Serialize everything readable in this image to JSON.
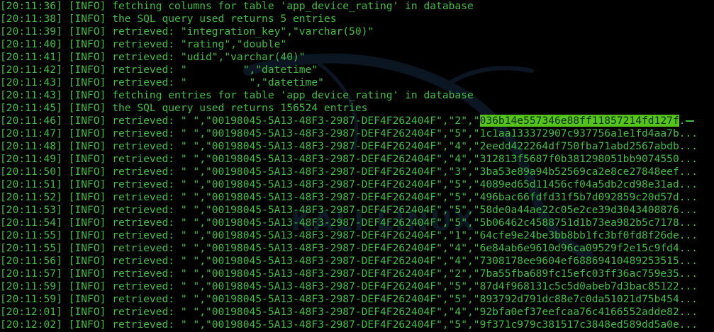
{
  "watermark": {
    "text": "KALI LINUX"
  },
  "lines": [
    {
      "time": "[20:11:36]",
      "level": "[INFO]",
      "msg": "fetching columns for table 'app_device_rating' in database"
    },
    {
      "time": "[20:11:38]",
      "level": "[INFO]",
      "msg": "the SQL query used returns 5 entries"
    },
    {
      "time": "[20:11:39]",
      "level": "[INFO]",
      "msg": "retrieved: \"integration_key\",\"varchar(50)\""
    },
    {
      "time": "[20:11:40]",
      "level": "[INFO]",
      "msg": "retrieved: \"rating\",\"double\""
    },
    {
      "time": "[20:11:41]",
      "level": "[INFO]",
      "msg": "retrieved: \"udid\",\"varchar(40)\""
    },
    {
      "time": "[20:11:42]",
      "level": "[INFO]",
      "msg": "retrieved: \"         \",\"datetime\""
    },
    {
      "time": "[20:11:43]",
      "level": "[INFO]",
      "msg": "retrieved: \"          \",\"datetime\""
    },
    {
      "time": "[20:11:43]",
      "level": "[INFO]",
      "msg": "fetching entries for table 'app_device_rating' in database"
    },
    {
      "time": "[20:11:45]",
      "level": "[INFO]",
      "msg": "the SQL query used returns 156524 entries"
    },
    {
      "time": "[20:11:46]",
      "level": "[INFO]",
      "msg": "retrieved: \" \",\"00198045-5A13-48F3-2987-DEF4F262404F\",\"2\",\"",
      "highlight": "036b14e557346e88ff11857214fd127f",
      "tail": ".",
      "cursor": true
    },
    {
      "time": "[20:11:47]",
      "level": "[INFO]",
      "msg": "retrieved: \" \",\"00198045-5A13-48F3-2987-DEF4F262404F\",\"5\",\"1c1aa133372907c937756a1e1fd4aa7b..."
    },
    {
      "time": "[20:11:48]",
      "level": "[INFO]",
      "msg": "retrieved: \" \",\"00198045-5A13-48F3-2987-DEF4F262404F\",\"4\",\"2eedd422264df750fba71abd2567abdb..."
    },
    {
      "time": "[20:11:49]",
      "level": "[INFO]",
      "msg": "retrieved: \" \",\"00198045-5A13-48F3-2987-DEF4F262404F\",\"4\",\"312813f5687f0b381298051bb9074550..."
    },
    {
      "time": "[20:11:50]",
      "level": "[INFO]",
      "msg": "retrieved: \" \",\"00198045-5A13-48F3-2987-DEF4F262404F\",\"3\",\"3ba53e89a94b52569ca2e8ce27848eef..."
    },
    {
      "time": "[20:11:51]",
      "level": "[INFO]",
      "msg": "retrieved: \" \",\"00198045-5A13-48F3-2987-DEF4F262404F\",\"5\",\"4089ed65d11456cf04a5db2cd98e31ad..."
    },
    {
      "time": "[20:11:52]",
      "level": "[INFO]",
      "msg": "retrieved: \" \",\"00198045-5A13-48F3-2987-DEF4F262404F\",\"5\",\"496bac66fdfd31f5b7d092859c20d57d..."
    },
    {
      "time": "[20:11:53]",
      "level": "[INFO]",
      "msg": "retrieved: \" \",\"00198045-5A13-48F3-2987-DEF4F262404F\",\"5\",\"58de0a44ae22c05e2ce39d3043408876..."
    },
    {
      "time": "[20:11:54]",
      "level": "[INFO]",
      "msg": "retrieved: \" \",\"00198045-5A13-48F3-2987-DEF4F262404F\",\"5\",\"5b06462c4588751d1b73ea982b5c7178..."
    },
    {
      "time": "[20:11:55]",
      "level": "[INFO]",
      "msg": "retrieved: \" \",\"00198045-5A13-48F3-2987-DEF4F262404F\",\"1\",\"64cfe9e24be3bb8bb1fc3bf0fd8f26de..."
    },
    {
      "time": "[20:11:55]",
      "level": "[INFO]",
      "msg": "retrieved: \" \",\"00198045-5A13-48F3-2987-DEF4F262404F\",\"4\",\"6e84ab6e9610d96ca09529f2e15c9fd4..."
    },
    {
      "time": "[20:11:56]",
      "level": "[INFO]",
      "msg": "retrieved: \" \",\"00198045-5A13-48F3-2987-DEF4F262404F\",\"4\",\"7308178ee9604ef68869410489253515..."
    },
    {
      "time": "[20:11:57]",
      "level": "[INFO]",
      "msg": "retrieved: \" \",\"00198045-5A13-48F3-2987-DEF4F262404F\",\"2\",\"7ba55fba689fc15efc03ff36ac759e35..."
    },
    {
      "time": "[20:11:59]",
      "level": "[INFO]",
      "msg": "retrieved: \" \",\"00198045-5A13-48F3-2987-DEF4F262404F\",\"5\",\"87d4f968131c5c5d0abeb7d3bac85122..."
    },
    {
      "time": "[20:11:59]",
      "level": "[INFO]",
      "msg": "retrieved: \" \",\"00198045-5A13-48F3-2987-DEF4F262404F\",\"5\",\"893792d791dc88e7c0da51021d75b454..."
    },
    {
      "time": "[20:12:01]",
      "level": "[INFO]",
      "msg": "retrieved: \" \",\"00198045-5A13-48F3-2987-DEF4F262404F\",\"4\",\"92bfa0ef37eefcaa76c4166552adde82..."
    },
    {
      "time": "[20:12:02]",
      "level": "[INFO]",
      "msg": "retrieved: \" \",\"00198045-5A13-48F3-2987-DEF4F262404F\",\"5\",\"9f371c979c381517c3848ed589dd5a0e..."
    }
  ],
  "colors": {
    "text": "#3fbf3f",
    "background": "#000000",
    "highlight": "#55c41a"
  }
}
